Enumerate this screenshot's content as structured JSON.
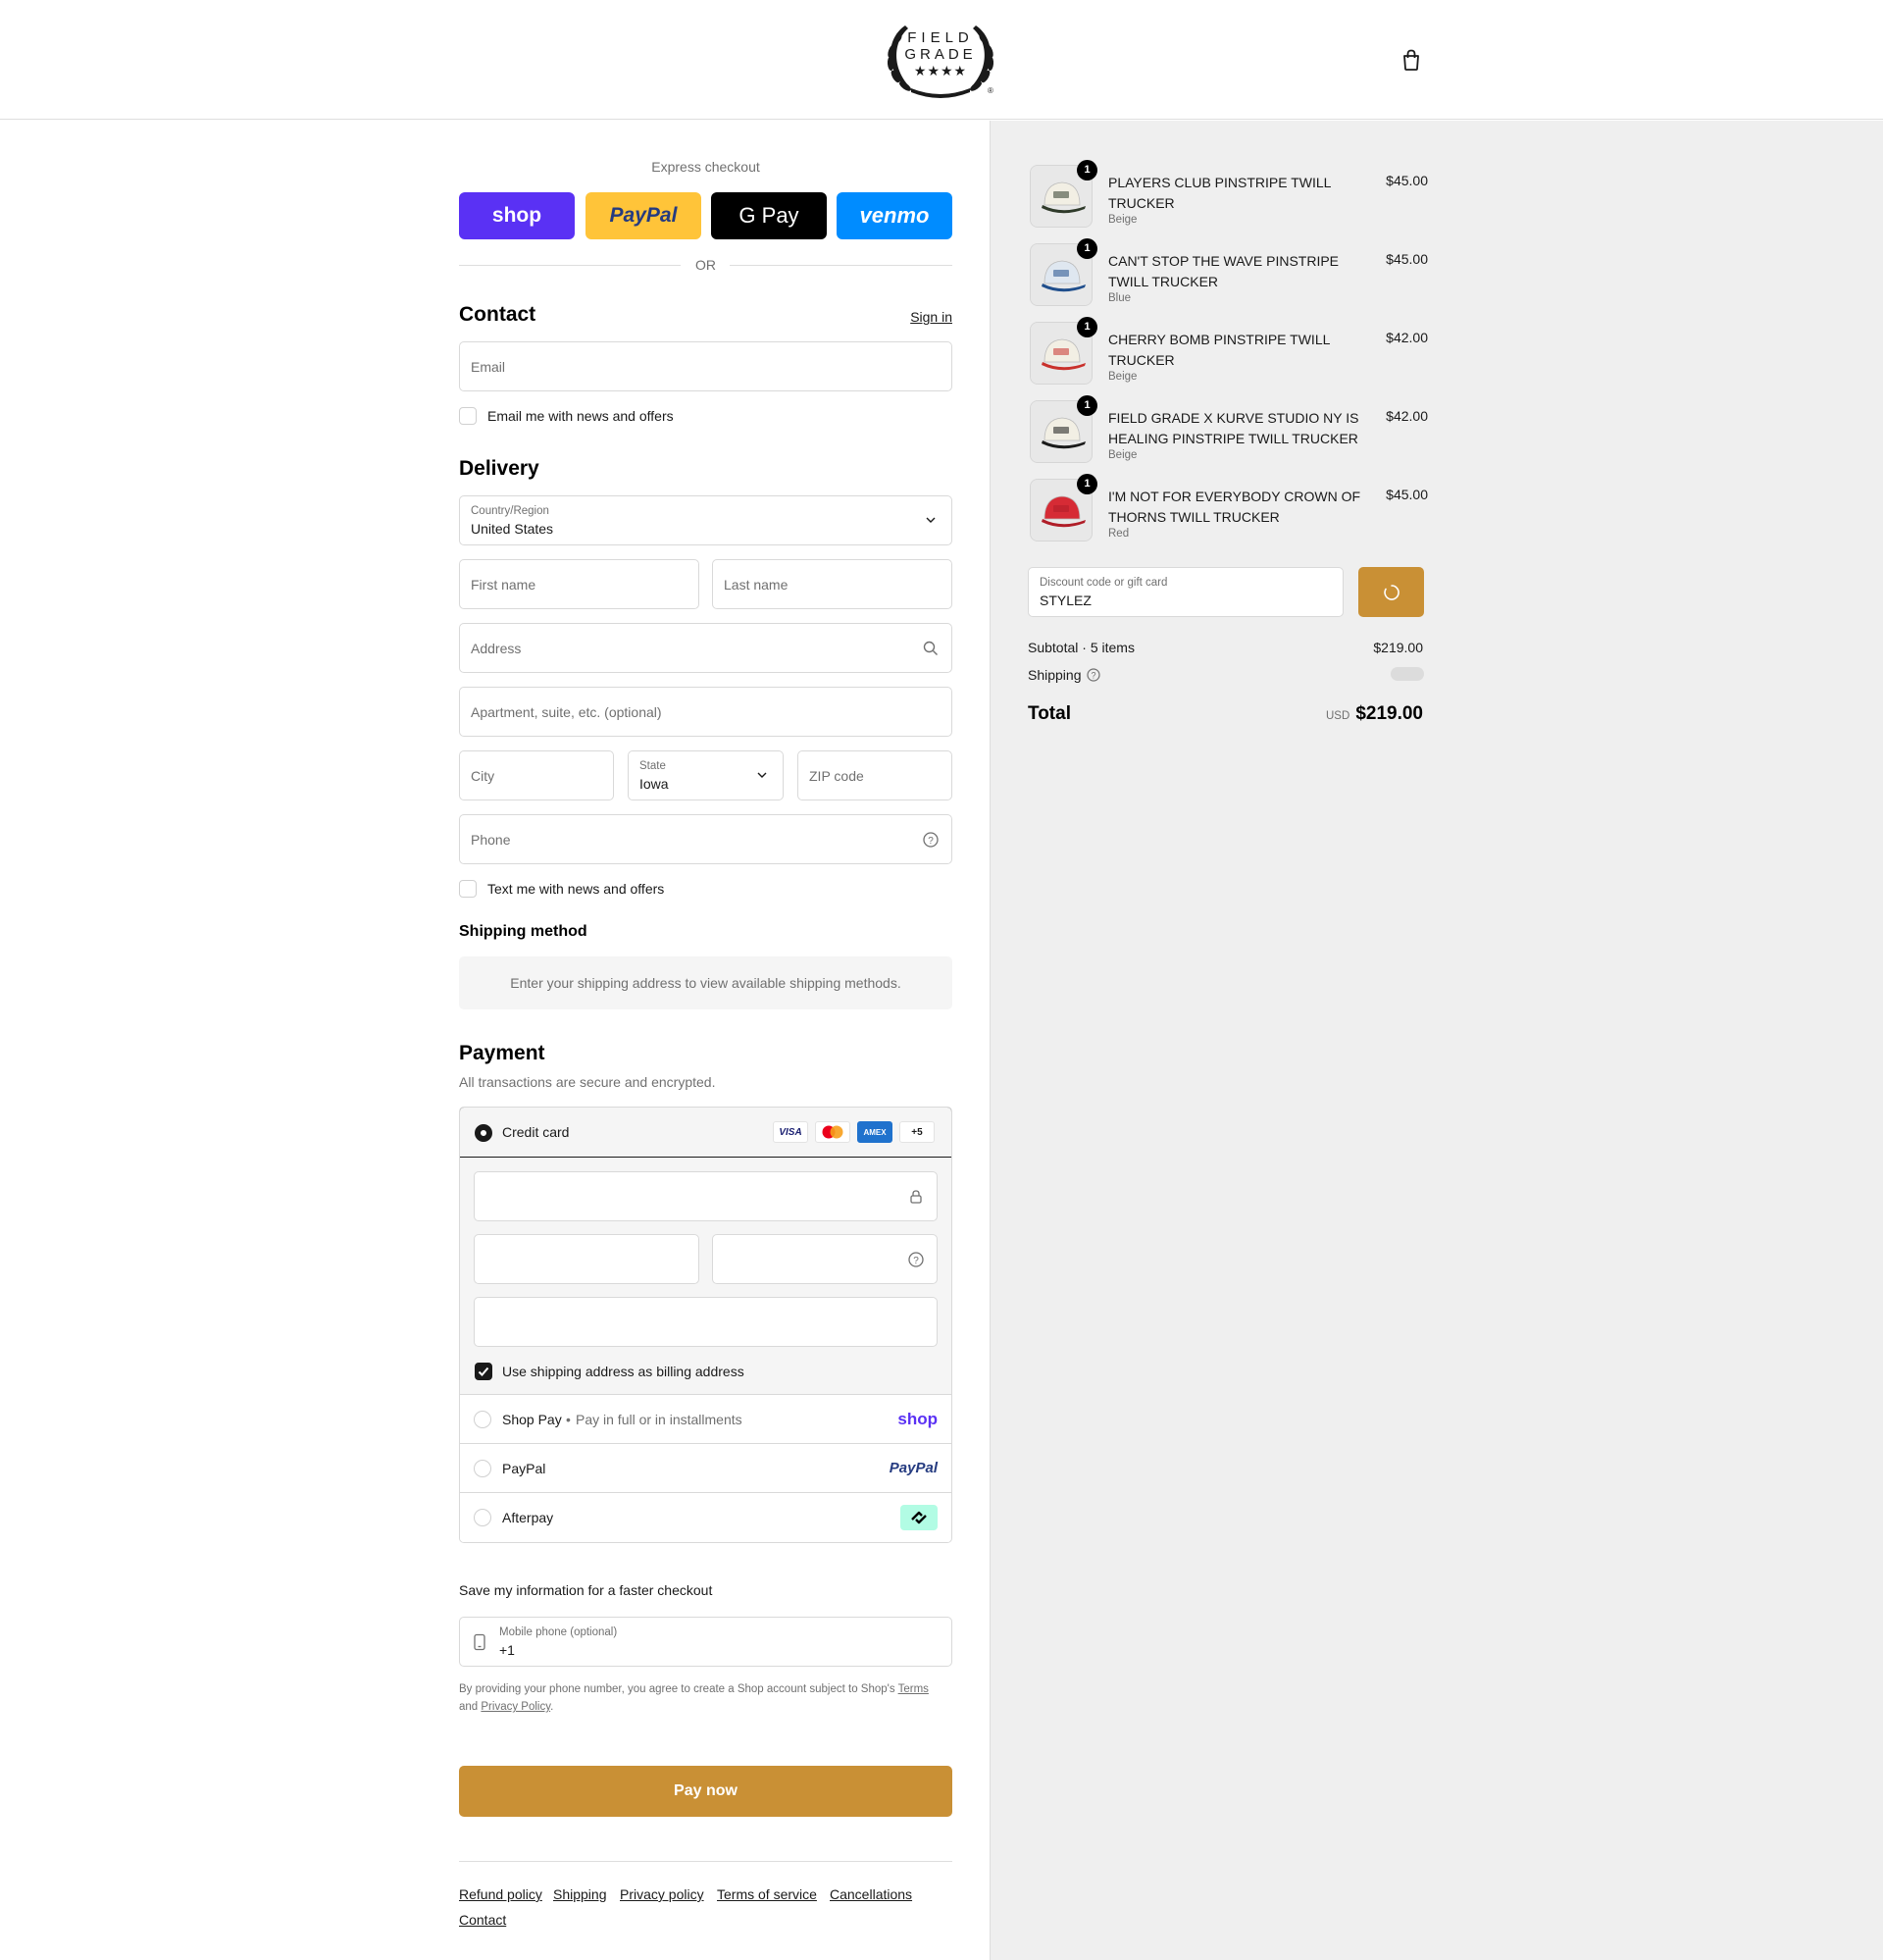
{
  "header": {
    "logo_text_line1": "FIELD",
    "logo_text_line2": "GRADE",
    "logo_mark": "★★★★",
    "cart_icon": "shopping-bag-icon"
  },
  "express": {
    "title": "Express checkout",
    "buttons": [
      {
        "label": "shop",
        "color": "#5a31f4"
      },
      {
        "label": "PayPal",
        "color": "#ffc439"
      },
      {
        "label": "G Pay",
        "color": "#000000"
      },
      {
        "label": "venmo",
        "color": "#008cff"
      }
    ],
    "or": "OR"
  },
  "contact": {
    "title": "Contact",
    "sign_in": "Sign in",
    "email_placeholder": "Email",
    "email_news": "Email me with news and offers"
  },
  "delivery": {
    "title": "Delivery",
    "country_label": "Country/Region",
    "country_value": "United States",
    "first_name": "First name",
    "last_name": "Last name",
    "address": "Address",
    "apartment": "Apartment, suite, etc. (optional)",
    "city": "City",
    "state_label": "State",
    "state_value": "Iowa",
    "zip": "ZIP code",
    "phone": "Phone",
    "text_news": "Text me with news and offers"
  },
  "shipping_method": {
    "title": "Shipping method",
    "message": "Enter your shipping address to view available shipping methods."
  },
  "payment": {
    "title": "Payment",
    "subtitle": "All transactions are secure and encrypted.",
    "credit_card": "Credit card",
    "card_logos": [
      "VISA",
      "MC",
      "AMEX",
      "+5"
    ],
    "billing_same": "Use shipping address as billing address",
    "shop_pay": "Shop Pay",
    "shop_pay_sub": "Pay in full or in installments",
    "shop_pay_logo": "shop",
    "paypal": "PayPal",
    "paypal_logo": "PayPal",
    "afterpay": "Afterpay"
  },
  "save_info": {
    "title": "Save my information for a faster checkout",
    "mobile_label": "Mobile phone (optional)",
    "mobile_value": "+1",
    "legal_pre": "By providing your phone number, you agree to create a Shop account subject to Shop's",
    "terms": "Terms",
    "and": "and",
    "privacy": "Privacy Policy",
    "period": "."
  },
  "pay_now": "Pay now",
  "footer_links": [
    "Refund policy",
    "Shipping",
    "Privacy policy",
    "Terms of service",
    "Cancellations",
    "Contact"
  ],
  "cart": {
    "items": [
      {
        "qty": "1",
        "name": "PLAYERS CLUB PINSTRIPE TWILL TRUCKER",
        "variant": "Beige",
        "price": "$45.00",
        "cap_color": "#f2efe4",
        "brim_color": "#2f3a2a"
      },
      {
        "qty": "1",
        "name": "CAN'T STOP THE WAVE PINSTRIPE TWILL TRUCKER",
        "variant": "Blue",
        "price": "$45.00",
        "cap_color": "#dfe7f0",
        "brim_color": "#1f4e8c"
      },
      {
        "qty": "1",
        "name": "CHERRY BOMB PINSTRIPE TWILL TRUCKER",
        "variant": "Beige",
        "price": "$42.00",
        "cap_color": "#f2efe4",
        "brim_color": "#c9312c"
      },
      {
        "qty": "1",
        "name": "FIELD GRADE X KURVE STUDIO NY IS HEALING PINSTRIPE TWILL TRUCKER",
        "variant": "Beige",
        "price": "$42.00",
        "cap_color": "#f2efe4",
        "brim_color": "#1a1a1a"
      },
      {
        "qty": "1",
        "name": "I'M NOT FOR EVERYBODY CROWN OF THORNS TWILL TRUCKER",
        "variant": "Red",
        "price": "$45.00",
        "cap_color": "#d62b35",
        "brim_color": "#b01e28"
      }
    ],
    "discount_label": "Discount code or gift card",
    "discount_value": "STYLEZ",
    "subtotal_label": "Subtotal · 5 items",
    "subtotal_value": "$219.00",
    "shipping_label": "Shipping",
    "total_label": "Total",
    "currency": "USD",
    "total_value": "$219.00",
    "accent": "#c99035"
  }
}
